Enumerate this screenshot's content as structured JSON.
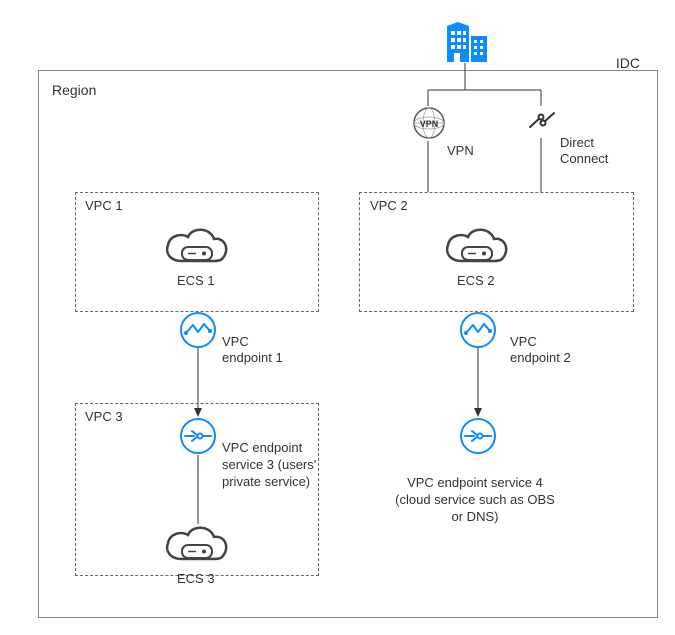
{
  "region": {
    "label": "Region"
  },
  "idc": {
    "label": "IDC"
  },
  "vpn": {
    "label": "VPN"
  },
  "direct_connect": {
    "label": "Direct\nConnect"
  },
  "vpc1": {
    "label": "VPC 1"
  },
  "vpc2": {
    "label": "VPC 2"
  },
  "vpc3": {
    "label": "VPC 3"
  },
  "ecs1": {
    "label": "ECS 1"
  },
  "ecs2": {
    "label": "ECS 2"
  },
  "ecs3": {
    "label": "ECS 3"
  },
  "endpoint1": {
    "label": "VPC\nendpoint 1"
  },
  "endpoint2": {
    "label": "VPC\nendpoint 2"
  },
  "service3": {
    "label": "VPC endpoint service 3 (users' private service)"
  },
  "service4": {
    "label": "VPC endpoint service 4 (cloud service such as OBS or DNS)"
  },
  "colors": {
    "accent": "#0d8cff",
    "line": "#333333",
    "border": "#888888"
  }
}
